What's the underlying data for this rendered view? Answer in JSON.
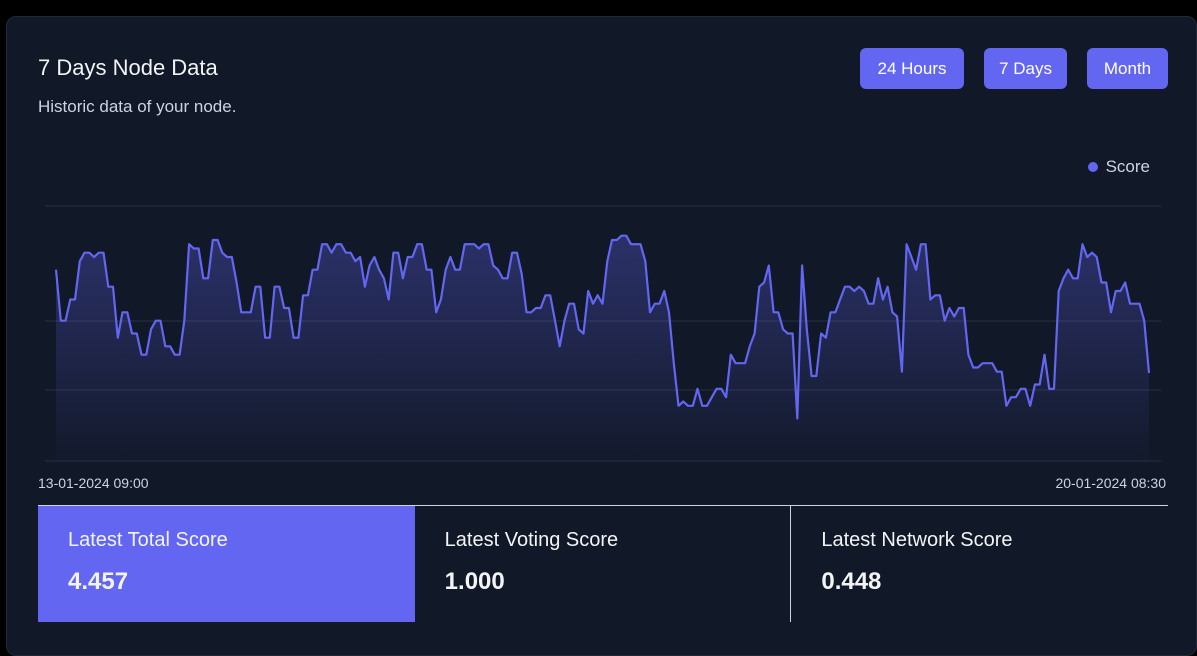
{
  "card": {
    "title": "7 Days Node Data",
    "subtitle": "Historic data of your node."
  },
  "range_buttons": [
    "24 Hours",
    "7 Days",
    "Month"
  ],
  "legend": {
    "label": "Score",
    "color": "#6366f1"
  },
  "chart_data": {
    "type": "area",
    "series": [
      {
        "name": "Score",
        "values": [
          4.7,
          4.58,
          4.58,
          4.63,
          4.63,
          4.72,
          4.74,
          4.74,
          4.73,
          4.74,
          4.74,
          4.66,
          4.66,
          4.54,
          4.6,
          4.6,
          4.55,
          4.55,
          4.5,
          4.5,
          4.56,
          4.58,
          4.58,
          4.52,
          4.52,
          4.5,
          4.5,
          4.58,
          4.76,
          4.75,
          4.75,
          4.68,
          4.68,
          4.77,
          4.77,
          4.74,
          4.73,
          4.73,
          4.67,
          4.6,
          4.6,
          4.6,
          4.66,
          4.66,
          4.54,
          4.54,
          4.66,
          4.66,
          4.61,
          4.61,
          4.54,
          4.54,
          4.64,
          4.64,
          4.7,
          4.7,
          4.76,
          4.76,
          4.74,
          4.76,
          4.76,
          4.74,
          4.74,
          4.72,
          4.73,
          4.66,
          4.71,
          4.73,
          4.7,
          4.68,
          4.63,
          4.74,
          4.74,
          4.68,
          4.73,
          4.73,
          4.76,
          4.76,
          4.7,
          4.7,
          4.6,
          4.63,
          4.7,
          4.73,
          4.7,
          4.7,
          4.76,
          4.76,
          4.76,
          4.75,
          4.76,
          4.76,
          4.71,
          4.7,
          4.68,
          4.68,
          4.74,
          4.74,
          4.69,
          4.6,
          4.6,
          4.61,
          4.61,
          4.64,
          4.64,
          4.58,
          4.52,
          4.58,
          4.62,
          4.62,
          4.56,
          4.55,
          4.65,
          4.62,
          4.64,
          4.62,
          4.72,
          4.77,
          4.77,
          4.78,
          4.78,
          4.76,
          4.76,
          4.76,
          4.72,
          4.6,
          4.62,
          4.62,
          4.65,
          4.6,
          4.48,
          4.38,
          4.39,
          4.38,
          4.38,
          4.42,
          4.38,
          4.38,
          4.4,
          4.42,
          4.42,
          4.4,
          4.5,
          4.48,
          4.48,
          4.48,
          4.52,
          4.55,
          4.66,
          4.67,
          4.71,
          4.6,
          4.6,
          4.56,
          4.55,
          4.55,
          4.35,
          4.71,
          4.56,
          4.45,
          4.45,
          4.55,
          4.54,
          4.6,
          4.6,
          4.63,
          4.66,
          4.66,
          4.65,
          4.66,
          4.65,
          4.62,
          4.62,
          4.68,
          4.63,
          4.66,
          4.6,
          4.59,
          4.46,
          4.76,
          4.73,
          4.7,
          4.76,
          4.76,
          4.63,
          4.64,
          4.64,
          4.58,
          4.61,
          4.59,
          4.61,
          4.61,
          4.5,
          4.47,
          4.47,
          4.48,
          4.48,
          4.48,
          4.46,
          4.46,
          4.38,
          4.4,
          4.4,
          4.42,
          4.42,
          4.38,
          4.43,
          4.43,
          4.5,
          4.42,
          4.42,
          4.65,
          4.68,
          4.7,
          4.68,
          4.68,
          4.76,
          4.73,
          4.74,
          4.73,
          4.67,
          4.67,
          4.6,
          4.65,
          4.65,
          4.67,
          4.62,
          4.62,
          4.62,
          4.58,
          4.457
        ]
      }
    ],
    "x_labels": [
      "13-01-2024 09:00",
      "20-01-2024 08:30"
    ],
    "y_range": [
      4.25,
      4.85
    ],
    "grid": true,
    "legend_position": "top-right"
  },
  "stats": [
    {
      "label": "Latest Total Score",
      "value": "4.457",
      "active": true
    },
    {
      "label": "Latest Voting Score",
      "value": "1.000",
      "active": false
    },
    {
      "label": "Latest Network Score",
      "value": "0.448",
      "active": false
    }
  ]
}
